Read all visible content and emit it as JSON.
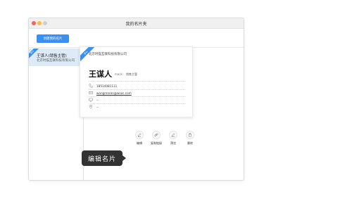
{
  "window": {
    "title": "我的名片夹"
  },
  "toolbar": {
    "create_label": "创建我的名片"
  },
  "sidebar": {
    "items": [
      {
        "ribbon": "默认",
        "name": "王谋人(销售主管)",
        "company": "北京时猫互联科技有限公司"
      }
    ]
  },
  "card": {
    "ribbon": "默认",
    "company": "北京时猫互联科技有限公司",
    "name": "王谋人",
    "english_name": "mack",
    "title": "销售主管",
    "phone": "18514081111",
    "email": "wangmoren@wsec.com",
    "fax": "--",
    "address": "--"
  },
  "actions": [
    {
      "label": "编辑",
      "icon": "edit-icon"
    },
    {
      "label": "复制链接",
      "icon": "link-icon"
    },
    {
      "label": "预览",
      "icon": "preview-icon"
    },
    {
      "label": "删除",
      "icon": "delete-icon"
    }
  ],
  "tooltip": {
    "text": "编辑名片"
  },
  "colors": {
    "accent": "#3b8fee",
    "sidebar_selected": "#ddebf8",
    "tooltip_bg": "#333333"
  }
}
